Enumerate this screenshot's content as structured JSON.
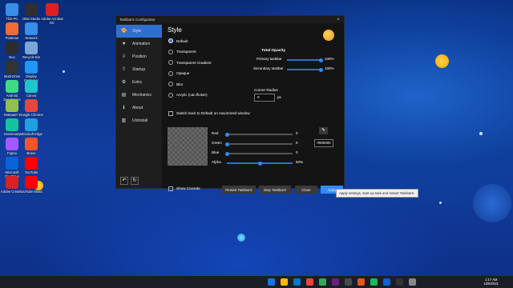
{
  "desktop": {
    "icons": [
      {
        "label": "This PC",
        "color": "#3a8ee6"
      },
      {
        "label": "OBS Studio",
        "color": "#302e31"
      },
      {
        "label": "Adobe Acrobat DC",
        "color": "#e02020"
      },
      {
        "label": "Network",
        "color": "#3a8ee6"
      },
      {
        "label": "Postman",
        "color": "#ef6c37"
      },
      {
        "label": "Recycle Bin",
        "color": "#7aa6d8"
      },
      {
        "label": "Nox",
        "color": "#2c2c2c"
      },
      {
        "label": "Display Optimizer",
        "color": "#2196f3"
      },
      {
        "label": "Multi-Drive",
        "color": "#333"
      },
      {
        "label": "Canva",
        "color": "#20c4cb"
      },
      {
        "label": "Android Developers",
        "color": "#3ddc84"
      },
      {
        "label": "Google Chrome",
        "color": "#e8453c"
      },
      {
        "label": "Notepad++",
        "color": "#90c050"
      },
      {
        "label": "Microsoft Edge",
        "color": "#1fa0e0"
      },
      {
        "label": "Grammarly",
        "color": "#15c39a"
      },
      {
        "label": "Brave",
        "color": "#fb542b"
      },
      {
        "label": "Figma",
        "color": "#a259ff"
      },
      {
        "label": "YouTube",
        "color": "#ff0000"
      },
      {
        "label": "Microsoft OneDrive",
        "color": "#0a64d6"
      },
      {
        "label": "YouTube Music",
        "color": "#ff0000"
      },
      {
        "label": "Adobe Creati...",
        "color": "#da1f26"
      }
    ]
  },
  "window": {
    "title": "TaskbarX Configurator",
    "close": "×",
    "nav": [
      {
        "label": "Style",
        "icon": "palette-icon",
        "glyph": "🎨",
        "active": true
      },
      {
        "label": "Animation",
        "icon": "heart-icon",
        "glyph": "♥",
        "active": false
      },
      {
        "label": "Position",
        "icon": "position-icon",
        "glyph": "⇩",
        "active": false
      },
      {
        "label": "Startup",
        "icon": "startup-icon",
        "glyph": "⇧",
        "active": false
      },
      {
        "label": "Extra",
        "icon": "gear-icon",
        "glyph": "⚙",
        "active": false
      },
      {
        "label": "Mechanics",
        "icon": "mechanics-icon",
        "glyph": "▤",
        "active": false
      },
      {
        "label": "About",
        "icon": "info-icon",
        "glyph": "ℹ",
        "active": false
      },
      {
        "label": "Uninstall",
        "icon": "trash-icon",
        "glyph": "▥",
        "active": false
      }
    ],
    "style": {
      "heading": "Style",
      "options": [
        "Default",
        "Transparent",
        "Transparent Gradient",
        "Opaque",
        "Blur",
        "Acrylic (can flicker)"
      ],
      "selected": 0,
      "opacity_title": "Total Opacity",
      "primary_label": "Primary taskbar",
      "primary_value": "100%",
      "primary_level": 1.0,
      "secondary_label": "Secondary taskbar",
      "secondary_value": "100%",
      "secondary_level": 1.0,
      "corner_label": "Corner Radius",
      "corner_value": "0",
      "corner_unit": "px",
      "switch_label": "Switch back to Default on maximized window"
    },
    "color": {
      "red_label": "Red",
      "red_value": "0",
      "red_level": 0,
      "green_label": "Green",
      "green_value": "0",
      "green_level": 0,
      "blue_label": "Blue",
      "blue_value": "0",
      "blue_level": 0,
      "alpha_label": "Alpha",
      "alpha_value": "50%",
      "alpha_level": 0.5,
      "hex": "#000000",
      "picker_glyph": "✎"
    },
    "footer": {
      "show_console": "Show Console",
      "restart": "Restart TaskbarX",
      "stop": "Stop TaskbarX",
      "close": "Close",
      "apply": "Apply",
      "tooltip": "Apply settings, start-up task and restart TaskbarX."
    }
  },
  "taskbar": {
    "time": "1:17 AM",
    "date": "10/8/2021",
    "accent": "#2f6fcf"
  }
}
